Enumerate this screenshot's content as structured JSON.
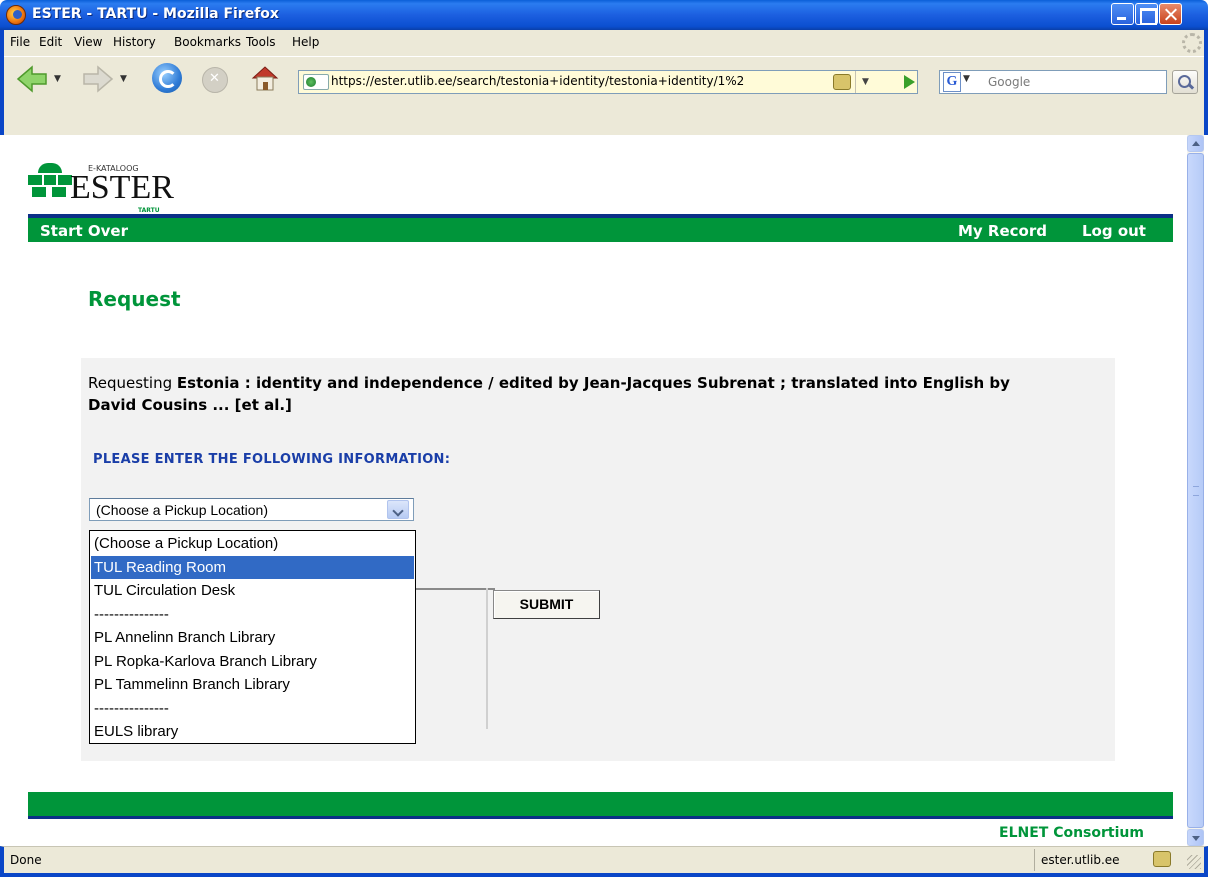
{
  "window": {
    "title": "ESTER - TARTU - Mozilla Firefox"
  },
  "menubar": {
    "items": [
      "File",
      "Edit",
      "View",
      "History",
      "Bookmarks",
      "Tools",
      "Help"
    ]
  },
  "toolbar": {
    "url": "https://ester.utlib.ee/search/testonia+identity/testonia+identity/1%2",
    "search_placeholder": "Google"
  },
  "logo": {
    "small_text": "E-KATALOOG",
    "main_text": "ESTER",
    "sub_text": "TARTU"
  },
  "nav": {
    "start_over": "Start Over",
    "my_record": "My Record",
    "log_out": "Log out"
  },
  "page": {
    "heading": "Request",
    "requesting_prefix": "Requesting ",
    "requesting_title": "Estonia : identity and independence / edited by Jean-Jacques Subrenat ; translated into English by David Cousins ... [et al.]",
    "instruction": "PLEASE ENTER THE FOLLOWING INFORMATION:"
  },
  "pickup_select": {
    "selected_value": "(Choose a Pickup Location)",
    "highlighted_index": 1,
    "options": [
      "(Choose a Pickup Location)",
      "TUL Reading Room",
      "TUL Circulation Desk",
      "---------------",
      "PL Annelinn Branch Library",
      "PL Ropka-Karlova Branch Library",
      "PL Tammelinn Branch Library",
      "---------------",
      "EULS library"
    ]
  },
  "submit_label": "SUBMIT",
  "footer": {
    "consortium": "ELNET Consortium"
  },
  "statusbar": {
    "status": "Done",
    "host": "ester.utlib.ee"
  },
  "colors": {
    "brand_green": "#00953a",
    "brand_blue": "#0b2f87",
    "selection": "#316ac5",
    "instruction_blue": "#1a3ea8"
  }
}
